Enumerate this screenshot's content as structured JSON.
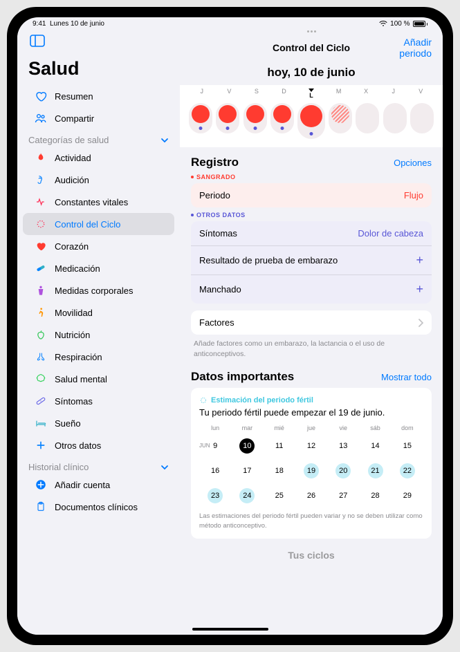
{
  "statusbar": {
    "time": "9:41",
    "date": "Lunes 10 de junio",
    "battery": "100 %"
  },
  "sidebar": {
    "appTitle": "Salud",
    "summary": "Resumen",
    "share": "Compartir",
    "categoriesHeader": "Categorías de salud",
    "items": [
      {
        "label": "Actividad"
      },
      {
        "label": "Audición"
      },
      {
        "label": "Constantes vitales"
      },
      {
        "label": "Control del Ciclo"
      },
      {
        "label": "Corazón"
      },
      {
        "label": "Medicación"
      },
      {
        "label": "Medidas corporales"
      },
      {
        "label": "Movilidad"
      },
      {
        "label": "Nutrición"
      },
      {
        "label": "Respiración"
      },
      {
        "label": "Salud mental"
      },
      {
        "label": "Síntomas"
      },
      {
        "label": "Sueño"
      },
      {
        "label": "Otros datos"
      }
    ],
    "recordsHeader": "Historial clínico",
    "addAccount": "Añadir cuenta",
    "clinicalDocs": "Documentos clínicos"
  },
  "main": {
    "title": "Control del Ciclo",
    "addPeriod": "Añadir periodo",
    "todayLabel": "hoy, 10 de junio",
    "weekDays": [
      "J",
      "V",
      "S",
      "D",
      "L",
      "M",
      "X",
      "J",
      "V"
    ],
    "registro": {
      "title": "Registro",
      "options": "Opciones",
      "sangrado": "SANGRADO",
      "periodo": "Periodo",
      "flujo": "Flujo",
      "otros": "OTROS DATOS",
      "sintomas": "Síntomas",
      "sintomasValue": "Dolor de cabeza",
      "embarazo": "Resultado de prueba de embarazo",
      "manchado": "Manchado",
      "factores": "Factores",
      "factoresHint": "Añade factores como un embarazo, la lactancia o el uso de anticonceptivos."
    },
    "highlights": {
      "title": "Datos importantes",
      "showAll": "Mostrar todo",
      "fertileTitle": "Estimación del periodo fértil",
      "fertileText": "Tu periodo fértil puede empezar el 19 de junio.",
      "calDays": [
        "lun",
        "mar",
        "mié",
        "jue",
        "vie",
        "sáb",
        "dom"
      ],
      "month": "JUN",
      "rows": [
        [
          9,
          10,
          11,
          12,
          13,
          14,
          15
        ],
        [
          16,
          17,
          18,
          19,
          20,
          21,
          22
        ],
        [
          23,
          24,
          25,
          26,
          27,
          28,
          29
        ]
      ],
      "note": "Las estimaciones del periodo fértil pueden variar y no se deben utilizar como método anticonceptivo."
    },
    "peek": "Tus ciclos"
  }
}
